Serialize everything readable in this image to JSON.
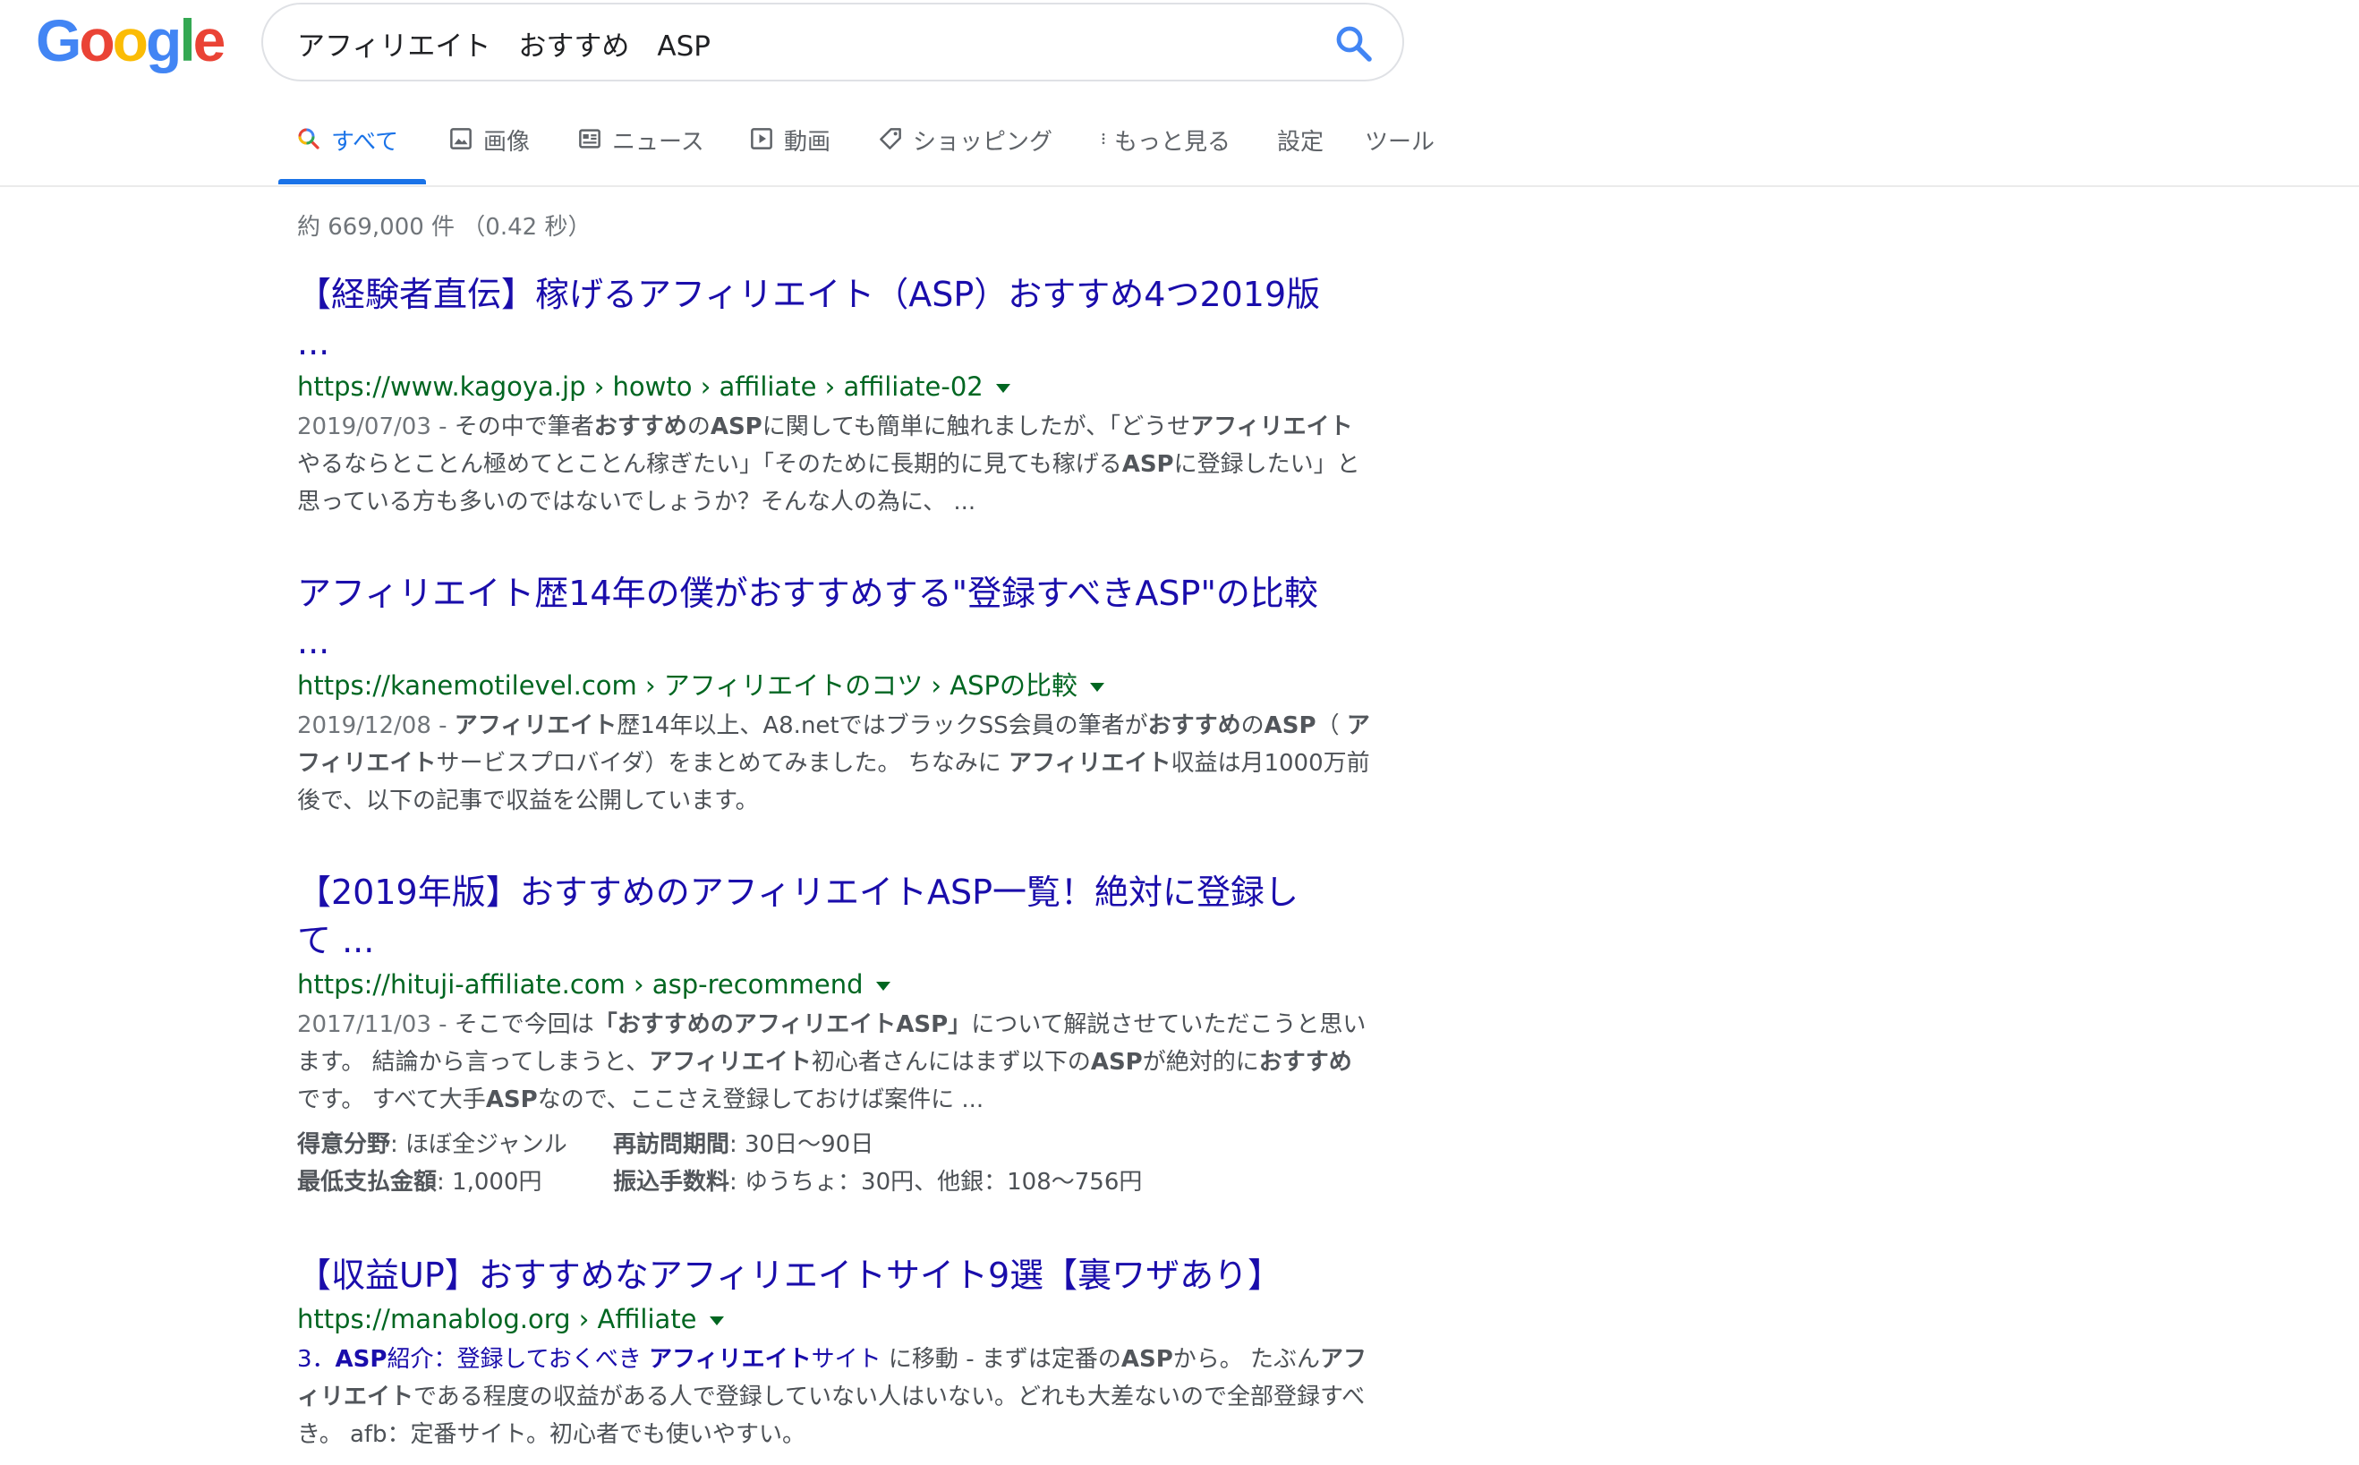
{
  "logo": {
    "text": "Google",
    "letters": [
      "G",
      "o",
      "o",
      "g",
      "l",
      "e"
    ]
  },
  "search": {
    "query": "アフィリエイト　おすすめ　ASP"
  },
  "tabs": [
    {
      "label": "すべて",
      "icon": "search-icon"
    },
    {
      "label": "画像",
      "icon": "image-icon"
    },
    {
      "label": "ニュース",
      "icon": "news-icon"
    },
    {
      "label": "動画",
      "icon": "video-icon"
    },
    {
      "label": "ショッピング",
      "icon": "tag-icon"
    },
    {
      "label": "もっと見る",
      "icon": "more-icon"
    },
    {
      "label": "設定",
      "icon": ""
    },
    {
      "label": "ツール",
      "icon": ""
    }
  ],
  "stats": "約 669,000 件 （0.42 秒）",
  "results": [
    {
      "title_line1": "【経験者直伝】稼げるアフィリエイト（ASP）おすすめ4つ2019版",
      "title_line2": "...",
      "url": "https://www.kagoya.jp › howto › affiliate › affiliate-02",
      "date": "2019/07/03 - ",
      "snippet": [
        {
          "t": "その中で筆者",
          "b": false
        },
        {
          "t": "おすすめ",
          "b": true
        },
        {
          "t": "の",
          "b": false
        },
        {
          "t": "ASP",
          "b": true
        },
        {
          "t": "に関しても簡単に触れましたが、「どうせ",
          "b": false
        },
        {
          "t": "アフィリエイト",
          "b": true
        },
        {
          "t": " やるならとことん極めてとことん稼ぎたい」「そのために長期的に見ても稼げる",
          "b": false
        },
        {
          "t": "ASP",
          "b": true
        },
        {
          "t": "に登録したい」と思っている方も多いのではないでしょうか？そんな人の為に、 ...",
          "b": false
        }
      ]
    },
    {
      "title_line1": "アフィリエイト歴14年の僕がおすすめする\"登録すべきASP\"の比較",
      "title_line2": "...",
      "url": "https://kanemotilevel.com › アフィリエイトのコツ › ASPの比較",
      "date": "2019/12/08 - ",
      "snippet": [
        {
          "t": "アフィリエイト",
          "b": true
        },
        {
          "t": "歴14年以上、A8.netではブラックSS会員の筆者が",
          "b": false
        },
        {
          "t": "おすすめ",
          "b": true
        },
        {
          "t": "の",
          "b": false
        },
        {
          "t": "ASP",
          "b": true
        },
        {
          "t": "（ ",
          "b": false
        },
        {
          "t": "アフィリエイト",
          "b": true
        },
        {
          "t": "サービスプロバイダ）をまとめてみました。 ちなみに ",
          "b": false
        },
        {
          "t": "アフィリエイト",
          "b": true
        },
        {
          "t": "収益は月1000万前後で、以下の記事で収益を公開しています。",
          "b": false
        }
      ]
    },
    {
      "title_line1": "【2019年版】おすすめのアフィリエイトASP一覧！絶対に登録し",
      "title_line2": "て ...",
      "url": "https://hituji-affiliate.com › asp-recommend",
      "date": "2017/11/03 - ",
      "snippet": [
        {
          "t": "そこで今回は",
          "b": false
        },
        {
          "t": "「おすすめのアフィリエイトASP」",
          "b": true
        },
        {
          "t": "について解説させていただこうと思います。 結論から言ってしまうと、",
          "b": false
        },
        {
          "t": "アフィリエイト",
          "b": true
        },
        {
          "t": "初心者さんにはまず以下の",
          "b": false
        },
        {
          "t": "ASP",
          "b": true
        },
        {
          "t": "が絶対的に",
          "b": false
        },
        {
          "t": "おすすめ",
          "b": true
        },
        {
          "t": "です。 すべて大手",
          "b": false
        },
        {
          "t": "ASP",
          "b": true
        },
        {
          "t": "なので、ここさえ登録しておけば案件に ...",
          "b": false
        }
      ],
      "facts": [
        [
          {
            "label": "得意分野",
            "value": ": ほぼ全ジャンル"
          },
          {
            "label": "再訪問期間",
            "value": ": 30日〜90日"
          }
        ],
        [
          {
            "label": "最低支払金額",
            "value": ": 1,000円"
          },
          {
            "label": "振込手数料",
            "value": ": ゆうちょ：30円、他銀：108〜756円"
          }
        ]
      ]
    },
    {
      "title_line1": "【収益UP】おすすめなアフィリエイトサイト9選【裏ワザあり】",
      "url": "https://manablog.org › Affiliate",
      "jump": [
        {
          "t": "3．",
          "b": false
        },
        {
          "t": "ASP",
          "b": true
        },
        {
          "t": "紹介：登録しておくべき ",
          "b": false
        },
        {
          "t": "アフィリエイト",
          "b": true
        },
        {
          "t": "サイト",
          "b": false
        }
      ],
      "jump_suffix": " に移動",
      "snippet": [
        {
          "t": " - まずは定番の",
          "b": false
        },
        {
          "t": "ASP",
          "b": true
        },
        {
          "t": "から。 たぶん",
          "b": false
        },
        {
          "t": "アフィリエイト",
          "b": true
        },
        {
          "t": "である程度の収益がある人で登録していない人はいない。どれも大差ないので全部登録すべき。 afb：定番サイト。初心者でも使いやすい。",
          "b": false
        }
      ]
    }
  ]
}
